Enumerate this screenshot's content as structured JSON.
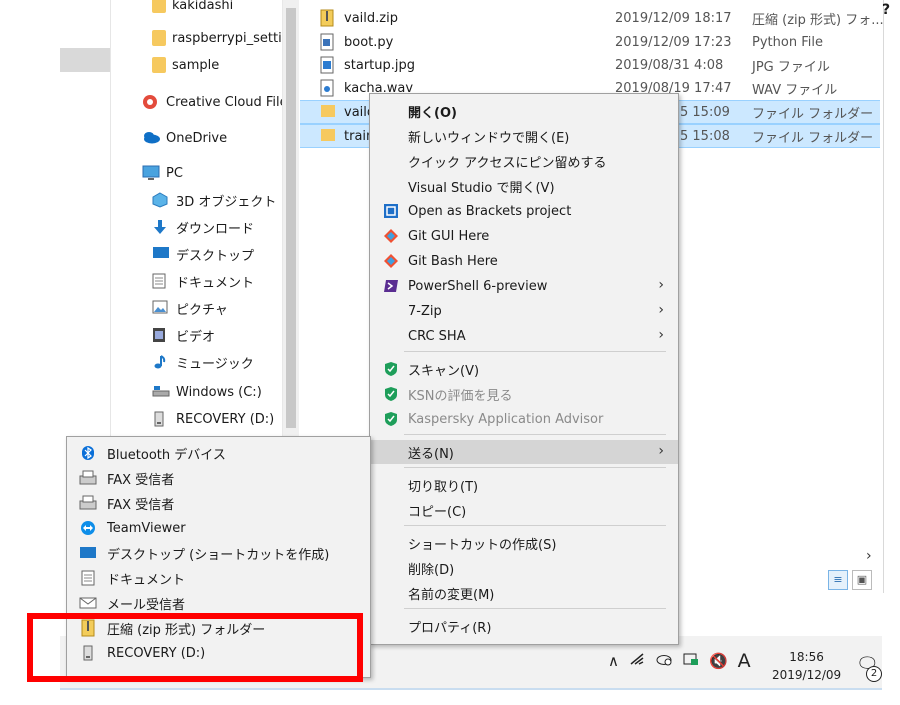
{
  "nav": {
    "items": [
      {
        "label": "kakidashi",
        "icon": "folder-icon"
      },
      {
        "label": "raspberrypi_setti",
        "icon": "folder-icon"
      },
      {
        "label": "sample",
        "icon": "folder-icon"
      },
      {
        "label": "Creative Cloud File",
        "icon": "creative-cloud-icon"
      },
      {
        "label": "OneDrive",
        "icon": "onedrive-icon"
      },
      {
        "label": "PC",
        "icon": "pc-icon"
      },
      {
        "label": "3D オブジェクト",
        "icon": "3d-objects-icon"
      },
      {
        "label": "ダウンロード",
        "icon": "download-icon"
      },
      {
        "label": "デスクトップ",
        "icon": "desktop-icon"
      },
      {
        "label": "ドキュメント",
        "icon": "documents-icon"
      },
      {
        "label": "ピクチャ",
        "icon": "pictures-icon"
      },
      {
        "label": "ビデオ",
        "icon": "videos-icon"
      },
      {
        "label": "ミュージック",
        "icon": "music-icon"
      },
      {
        "label": "Windows (C:)",
        "icon": "drive-icon"
      },
      {
        "label": "RECOVERY (D:)",
        "icon": "drive-icon"
      }
    ]
  },
  "files": [
    {
      "name": "vaild.zip",
      "date": "2019/12/09 18:17",
      "type": "圧縮 (zip 形式) フォ...",
      "icon": "zip-icon"
    },
    {
      "name": "boot.py",
      "date": "2019/12/09 17:23",
      "type": "Python File",
      "icon": "python-file-icon"
    },
    {
      "name": "startup.jpg",
      "date": "2019/08/31 4:08",
      "type": "JPG ファイル",
      "icon": "image-file-icon"
    },
    {
      "name": "kacha.wav",
      "date": "2019/08/19 17:47",
      "type": "WAV ファイル",
      "icon": "audio-file-icon"
    },
    {
      "name": "vaild",
      "date": "5 15:09",
      "type": "ファイル フォルダー",
      "icon": "folder-icon"
    },
    {
      "name": "train",
      "date": "5 15:08",
      "type": "ファイル フォルダー",
      "icon": "folder-icon"
    }
  ],
  "context_menu": {
    "items": [
      {
        "label": "開く(O)",
        "bold": true
      },
      {
        "label": "新しいウィンドウで開く(E)"
      },
      {
        "label": "クイック アクセスにピン留めする"
      },
      {
        "label": "Visual Studio で開く(V)"
      },
      {
        "label": "Open as Brackets project",
        "icon": "brackets-icon"
      },
      {
        "label": "Git GUI Here",
        "icon": "git-icon"
      },
      {
        "label": "Git Bash Here",
        "icon": "git-icon"
      },
      {
        "label": "PowerShell 6-preview",
        "icon": "powershell-icon",
        "submenu": true
      },
      {
        "label": "7-Zip",
        "submenu": true
      },
      {
        "label": "CRC SHA",
        "submenu": true
      },
      {
        "label": "スキャン(V)",
        "icon": "kaspersky-icon"
      },
      {
        "label": "KSNの評価を見る",
        "icon": "kaspersky-icon",
        "disabled": true
      },
      {
        "label": "Kaspersky Application Advisor",
        "icon": "kaspersky-icon",
        "disabled": true
      },
      {
        "label": "送る(N)",
        "submenu": true,
        "highlighted": true
      },
      {
        "label": "切り取り(T)"
      },
      {
        "label": "コピー(C)"
      },
      {
        "label": "ショートカットの作成(S)"
      },
      {
        "label": "削除(D)"
      },
      {
        "label": "名前の変更(M)"
      },
      {
        "label": "プロパティ(R)"
      }
    ]
  },
  "send_to_menu": {
    "items": [
      {
        "label": "Bluetooth デバイス",
        "icon": "bluetooth-icon"
      },
      {
        "label": "FAX 受信者",
        "icon": "fax-icon"
      },
      {
        "label": "FAX 受信者",
        "icon": "fax-icon"
      },
      {
        "label": "TeamViewer",
        "icon": "teamviewer-icon"
      },
      {
        "label": "デスクトップ (ショートカットを作成)",
        "icon": "desktop-icon"
      },
      {
        "label": "ドキュメント",
        "icon": "documents-icon"
      },
      {
        "label": "メール受信者",
        "icon": "mail-icon"
      },
      {
        "label": "圧縮 (zip 形式) フォルダー",
        "icon": "zip-icon"
      },
      {
        "label": "RECOVERY (D:)",
        "icon": "drive-icon"
      }
    ]
  },
  "taskbar": {
    "time": "18:56",
    "date": "2019/12/09",
    "ime": "A",
    "notification_count": "2"
  },
  "colors": {
    "accent": "#0078d7",
    "selection": "#cce8ff",
    "highlight_box": "#ff0000"
  }
}
